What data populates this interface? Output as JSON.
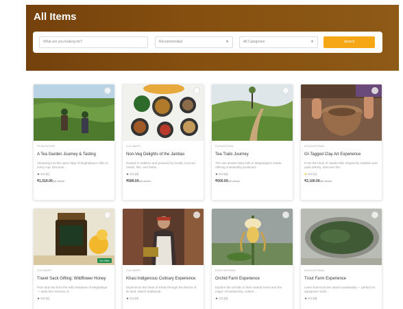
{
  "page": {
    "title": "All Items"
  },
  "search": {
    "placeholder": "What are you looking for?",
    "sort_value": "Recommended",
    "category_value": "All Categories",
    "button_label": "Search"
  },
  "cards": [
    {
      "category": "PLANTATION",
      "title": "A Tea Garden Journey & Tasting",
      "description": "Venturing into the quiet ridge of Meghalaya's Hills to every cup. Discover...",
      "rating": "5.0 (1)",
      "price": "₹1,519.00",
      "price_unit": "/per person",
      "star": "★",
      "image": "tea-garden"
    },
    {
      "category": "CULINARY",
      "title": "Non-Veg Delights of the Jaintias",
      "description": "Rooted in tradition and powered by locally sourced meats, fish, and herbs...",
      "rating": "0.0 (0)",
      "price": "₹589.00",
      "price_unit": "/per person",
      "star": "★",
      "image": "food-platter"
    },
    {
      "category": "PLANTATION",
      "title": "Tea Trails Journey",
      "description": "This sits amidst misty hills in Meghalaya's estate, offering sustainably produced...",
      "rating": "0.0 (0)",
      "price": "₹500.00",
      "price_unit": "/per person",
      "star": "★",
      "image": "tea-hill-path"
    },
    {
      "category": "EDUCATIONAL",
      "title": "GI-Tagged Clay Art Experience",
      "description": "From the heart of Jaintia Hills shaped by tradition and quiet artistry. Discover the...",
      "rating": "5.0 (1)",
      "price": "₹2,100.00",
      "price_unit": "/per person",
      "star": "★",
      "image": "clay-pottery"
    },
    {
      "category": "CULINARY",
      "title": "Travel Sack Gifting: Wildflower Honey",
      "description": "Pure and raw from the wild meadows of Meghalaya — taste the richness of...",
      "rating": "5.0 (1)",
      "price": "",
      "price_unit": "",
      "star": "★",
      "image": "honey-jar",
      "badge": "On Offer"
    },
    {
      "category": "CULINARY",
      "title": "Khasi Indigenous Culinary Experience",
      "description": "Experience the heart of Khasi through the flavors of its land. Watch traditional...",
      "rating": "0.0 (0)",
      "price": "",
      "price_unit": "",
      "star": "★",
      "image": "cook"
    },
    {
      "category": "EDUCATIONAL",
      "title": "Orchid Farm Experience",
      "description": "Explore the orchids in their natural home and the magic of biodiversity, culture...",
      "rating": "0.0 (0)",
      "price": "",
      "price_unit": "",
      "star": "★",
      "image": "orchid"
    },
    {
      "category": "EDUCATIONAL",
      "title": "Trout Farm Experience",
      "description": "Learn how trout are raised sustainably — perfect for aquaponic visits...",
      "rating": "0.0 (0)",
      "price": "",
      "price_unit": "",
      "star": "★",
      "image": "trout-pond"
    }
  ]
}
